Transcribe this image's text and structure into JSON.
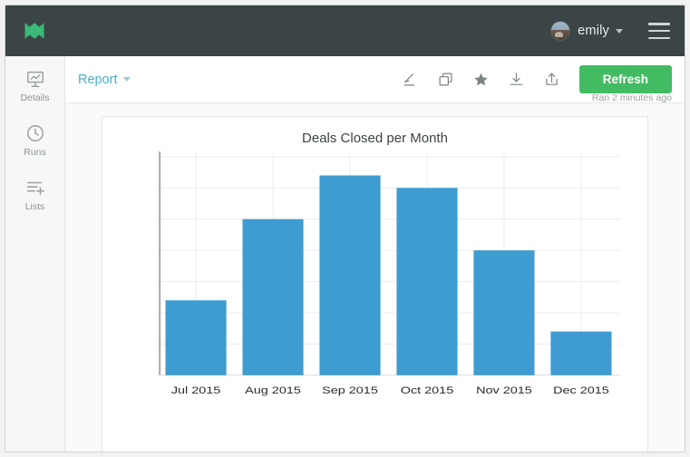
{
  "navbar": {
    "logo_icon": "m-logo-icon",
    "username": "emily",
    "user_caret_icon": "chevron-down-icon",
    "menu_icon": "hamburger-menu-icon",
    "avatar_icon": "user-avatar"
  },
  "sidebar": {
    "items": [
      {
        "label": "Details",
        "icon": "presentation-chart-icon"
      },
      {
        "label": "Runs",
        "icon": "clock-icon"
      },
      {
        "label": "Lists",
        "icon": "list-add-icon"
      }
    ]
  },
  "toolbar": {
    "report_label": "Report",
    "report_caret_icon": "chevron-down-icon",
    "icons": [
      {
        "name": "edit-pencil-icon"
      },
      {
        "name": "duplicate-icon"
      },
      {
        "name": "star-icon"
      },
      {
        "name": "download-icon"
      },
      {
        "name": "share-upload-icon"
      }
    ],
    "refresh_label": "Refresh",
    "ran_status": "Ran 2 minutes ago"
  },
  "colors": {
    "navbar_bg": "#3b4545",
    "logo_green": "#3cb878",
    "refresh_green": "#43bb63",
    "link_blue": "#4cadc9",
    "bar_blue": "#3e9cd1",
    "grid": "#ececec"
  },
  "chart_data": {
    "type": "bar",
    "title": "Deals Closed per Month",
    "xlabel": "",
    "ylabel": "",
    "categories": [
      "Jul 2015",
      "Aug 2015",
      "Sep 2015",
      "Oct 2015",
      "Nov 2015",
      "Dec 2015"
    ],
    "values": [
      12,
      25,
      32,
      30,
      20,
      7
    ],
    "ylim": [
      0,
      35
    ],
    "yticks": [
      0,
      5,
      10,
      15,
      20,
      25,
      30,
      35
    ],
    "ytick_labels_visible": false,
    "grid": true,
    "grid_orientation": "both",
    "legend": false,
    "bar_color": "#3e9cd1",
    "series": [
      {
        "name": "Deals Closed",
        "values": [
          12,
          25,
          32,
          30,
          20,
          7
        ]
      }
    ]
  }
}
